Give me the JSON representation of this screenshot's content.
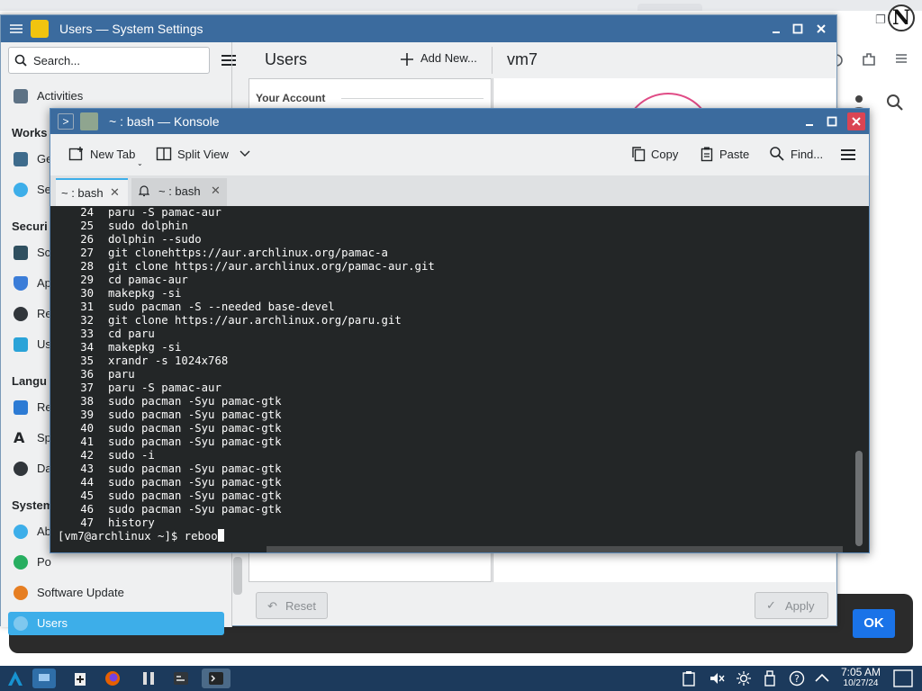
{
  "settings": {
    "window_title": "Users — System Settings",
    "search_placeholder": "Search...",
    "page_title": "Users",
    "add_new": "Add New...",
    "user_name": "vm7",
    "your_account": "Your Account",
    "reset": "Reset",
    "apply": "Apply",
    "sidebar": {
      "activities": "Activities",
      "head_workspace": "Works",
      "item_ge": "Ge",
      "item_se": "Se",
      "head_security": "Securi",
      "item_sc": "Sc",
      "item_ap": "Ap",
      "item_re1": "Re",
      "item_us": "Us",
      "head_language": "Langu",
      "item_re2": "Re",
      "item_sp": "Sp",
      "item_da": "Da",
      "head_system": "System",
      "item_ab": "Ab",
      "item_po": "Po",
      "software_update": "Software Update",
      "users": "Users"
    }
  },
  "konsole": {
    "window_title": "~ : bash — Konsole",
    "toolbar": {
      "new_tab": "New Tab",
      "split_view": "Split View",
      "copy": "Copy",
      "paste": "Paste",
      "find": "Find..."
    },
    "tabs": [
      {
        "label": "~ : bash"
      },
      {
        "label": "~ : bash"
      }
    ],
    "history": [
      {
        "n": "24",
        "cmd": "paru -S pamac-aur"
      },
      {
        "n": "25",
        "cmd": "sudo dolphin"
      },
      {
        "n": "26",
        "cmd": "dolphin --sudo"
      },
      {
        "n": "27",
        "cmd": "git clonehttps://aur.archlinux.org/pamac-a"
      },
      {
        "n": "28",
        "cmd": "git clone https://aur.archlinux.org/pamac-aur.git"
      },
      {
        "n": "29",
        "cmd": "cd pamac-aur"
      },
      {
        "n": "30",
        "cmd": "makepkg -si"
      },
      {
        "n": "31",
        "cmd": "sudo pacman -S --needed base-devel"
      },
      {
        "n": "32",
        "cmd": "git clone https://aur.archlinux.org/paru.git"
      },
      {
        "n": "33",
        "cmd": "cd paru"
      },
      {
        "n": "34",
        "cmd": "makepkg -si"
      },
      {
        "n": "35",
        "cmd": "xrandr -s 1024x768"
      },
      {
        "n": "36",
        "cmd": "paru"
      },
      {
        "n": "37",
        "cmd": "paru -S pamac-aur"
      },
      {
        "n": "38",
        "cmd": "sudo pacman -Syu pamac-gtk"
      },
      {
        "n": "39",
        "cmd": "sudo pacman -Syu pamac-gtk"
      },
      {
        "n": "40",
        "cmd": "sudo pacman -Syu pamac-gtk"
      },
      {
        "n": "41",
        "cmd": "sudo pacman -Syu pamac-gtk"
      },
      {
        "n": "42",
        "cmd": "sudo -i"
      },
      {
        "n": "43",
        "cmd": "sudo pacman -Syu pamac-gtk"
      },
      {
        "n": "44",
        "cmd": "sudo pacman -Syu pamac-gtk"
      },
      {
        "n": "45",
        "cmd": "sudo pacman -Syu pamac-gtk"
      },
      {
        "n": "46",
        "cmd": "sudo pacman -Syu pamac-gtk"
      },
      {
        "n": "47",
        "cmd": "history"
      }
    ],
    "prompt": "[vm7@archlinux ~]$ ",
    "input": "reboo"
  },
  "browser": {
    "ok_button": "OK"
  },
  "taskbar": {
    "time": "7:05 AM",
    "date": "10/27/24"
  },
  "colors": {
    "titlebar": "#3b6b9e",
    "accent": "#3daee9",
    "terminal_bg": "#232627",
    "taskbar": "#1c3a5c",
    "ok_blue": "#1a73e8"
  }
}
